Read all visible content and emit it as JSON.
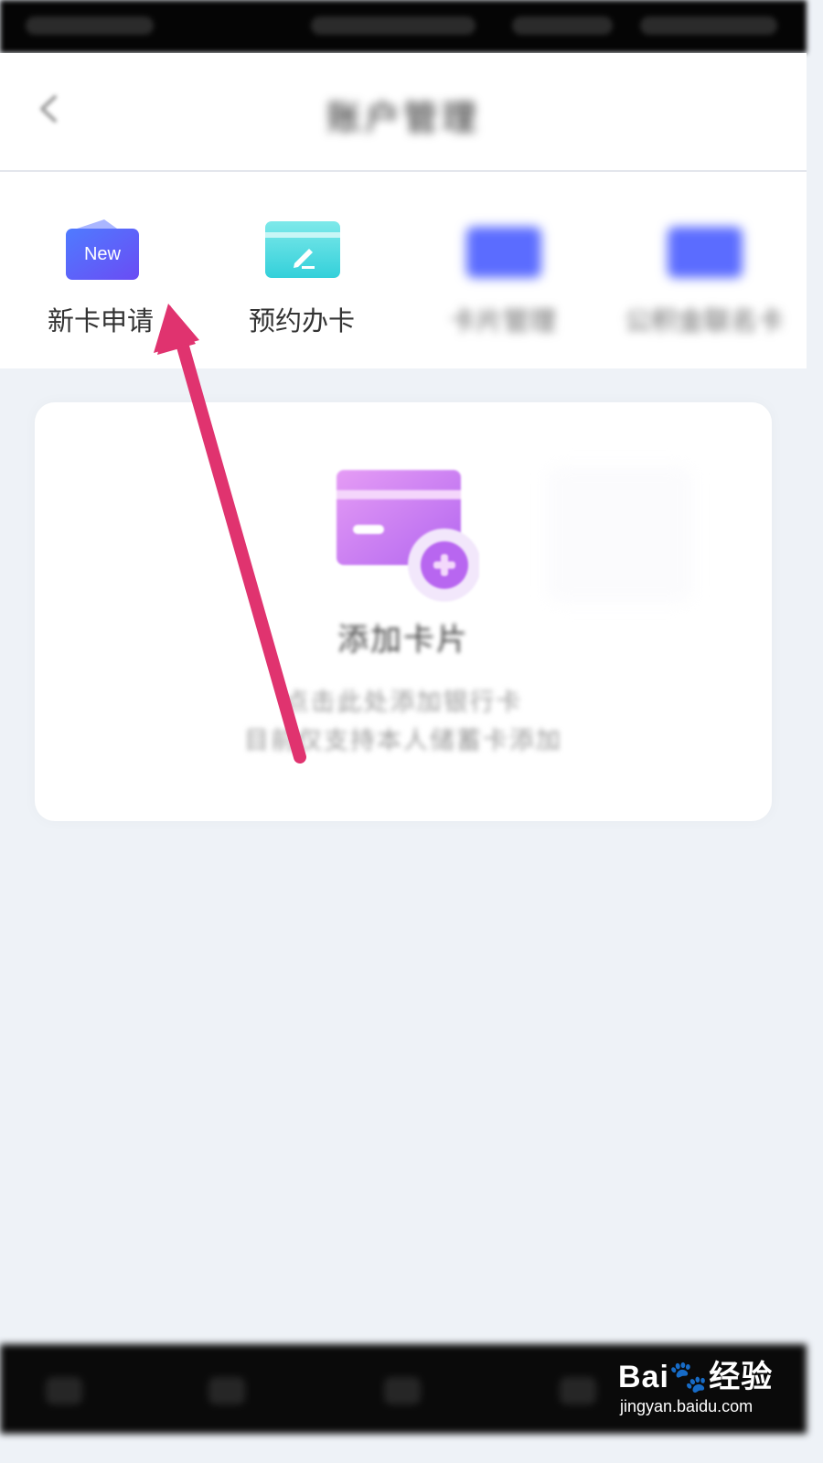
{
  "header": {
    "title": "账户管理",
    "back_icon": "chevron-left-icon"
  },
  "quick_actions": [
    {
      "label": "新卡申请",
      "icon": "new-card-icon",
      "icon_text": "New",
      "color": "#5a63f5"
    },
    {
      "label": "预约办卡",
      "icon": "card-edit-icon",
      "color": "#3ed6dc"
    },
    {
      "label": "卡片管理",
      "icon": "card-icon",
      "color": "#5b6cff"
    },
    {
      "label": "公积金联名卡",
      "icon": "card-icon",
      "color": "#5b6cff"
    }
  ],
  "add_card": {
    "icon": "add-card-icon",
    "title": "添加卡片",
    "hint_line1": "点击此处添加银行卡",
    "hint_line2": "目前仅支持本人储蓄卡添加",
    "color": "#c56af0"
  },
  "annotation": {
    "type": "arrow",
    "color": "#e0336f",
    "target": "新卡申请"
  },
  "watermark": {
    "logo_text": "Bai🐾经验",
    "url": "jingyan.baidu.com"
  }
}
